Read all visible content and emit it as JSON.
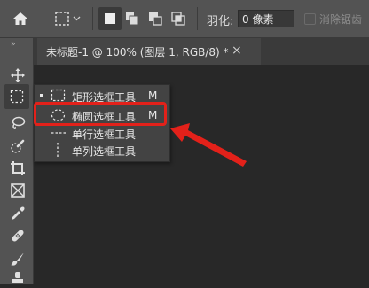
{
  "options_bar": {
    "home_icon": "home-icon",
    "marquee_preset_icon": "rect-marquee-preset-icon",
    "selection_modes": [
      "new-selection-icon",
      "add-to-selection-icon",
      "subtract-from-selection-icon",
      "intersect-selection-icon"
    ],
    "feather_label": "羽化:",
    "feather_value": "0 像素",
    "anti_alias_label": "消除锯齿"
  },
  "document_tab": {
    "title": "未标题-1 @ 100% (图层 1, RGB/8) *",
    "close": "×"
  },
  "toolbar": {
    "collapse": "»",
    "tools": [
      "move-tool-icon",
      "rect-marquee-tool-icon",
      "lasso-tool-icon",
      "quick-select-tool-icon",
      "crop-tool-icon",
      "frame-tool-icon",
      "eyedropper-tool-icon",
      "healing-brush-tool-icon",
      "brush-tool-icon",
      "stamp-tool-icon"
    ]
  },
  "flyout_menu": {
    "items": [
      {
        "label": "矩形选框工具",
        "shortcut": "M",
        "icon": "rect-marquee-icon",
        "active": true
      },
      {
        "label": "椭圆选框工具",
        "shortcut": "M",
        "icon": "ellipse-marquee-icon",
        "active": false
      },
      {
        "label": "单行选框工具",
        "shortcut": "",
        "icon": "single-row-marquee-icon",
        "active": false
      },
      {
        "label": "单列选框工具",
        "shortcut": "",
        "icon": "single-column-marquee-icon",
        "active": false
      }
    ]
  },
  "annotation": {
    "color": "#e3211a"
  }
}
